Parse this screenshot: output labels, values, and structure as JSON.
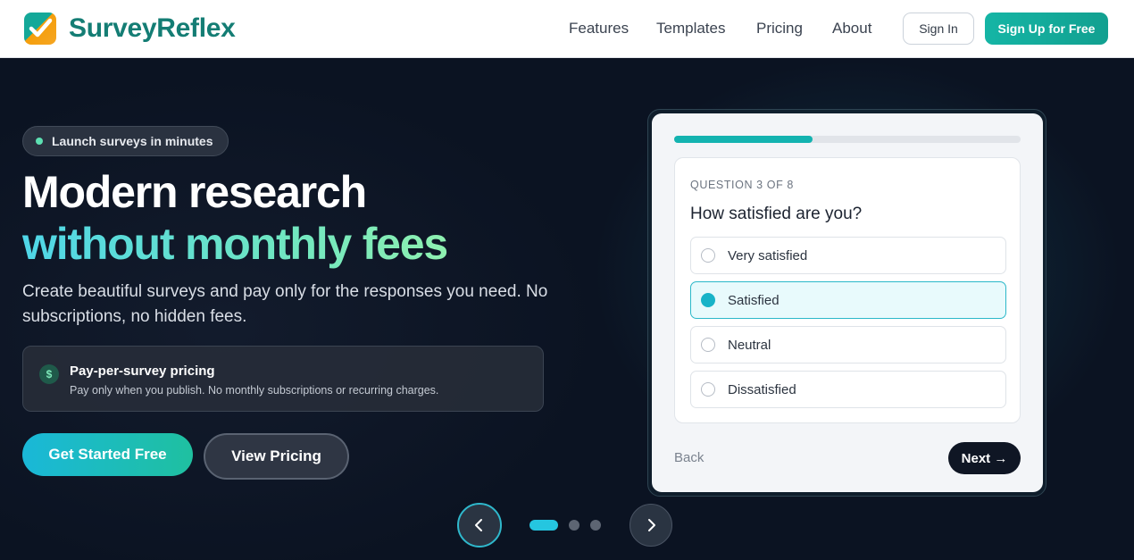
{
  "brand": {
    "name": "SurveyReflex",
    "icon": "checkmark-logo-icon",
    "colors": {
      "primary": "#147d74",
      "accent": "#15b5a5",
      "logo_orange": "#f5a623"
    }
  },
  "nav": {
    "links": [
      "Features",
      "Templates",
      "Pricing",
      "About"
    ],
    "signin_label": "Sign In",
    "signup_label": "Sign Up for Free"
  },
  "hero": {
    "badge": "Launch surveys in minutes",
    "headline_line1": "Modern research",
    "headline_line2": "without monthly fees",
    "subtitle": "Create beautiful surveys and pay only for the responses you need. No subscriptions, no hidden fees.",
    "feature": {
      "icon": "dollar-icon",
      "title": "Pay-per-survey pricing",
      "description": "Pay only when you publish. No monthly subscriptions or recurring charges."
    },
    "cta_primary": "Get Started Free",
    "cta_secondary": "View Pricing"
  },
  "survey_preview": {
    "progress_fraction": 0.4,
    "counter": "QUESTION 3 OF 8",
    "question": "How satisfied are you?",
    "options": [
      {
        "label": "Very satisfied",
        "selected": false
      },
      {
        "label": "Satisfied",
        "selected": true
      },
      {
        "label": "Neutral",
        "selected": false
      },
      {
        "label": "Dissatisfied",
        "selected": false
      }
    ],
    "back_label": "Back",
    "next_label": "Next →"
  },
  "carousel": {
    "active_index": 0,
    "slide_count": 3,
    "prev_icon": "chevron-left-icon",
    "next_icon": "chevron-right-icon"
  }
}
